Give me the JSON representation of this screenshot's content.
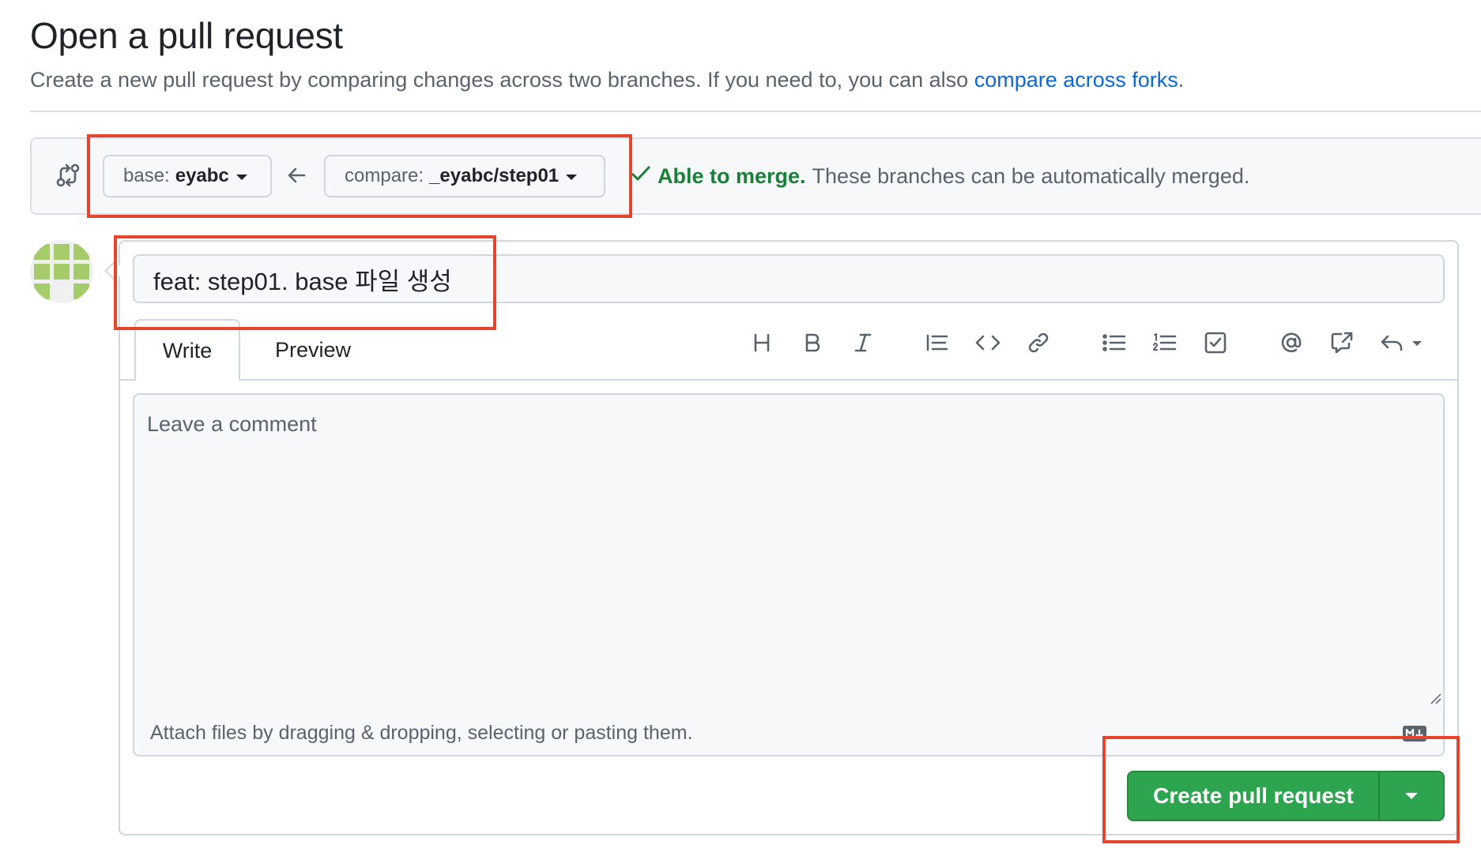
{
  "page": {
    "title": "Open a pull request",
    "subtitle_text": "Create a new pull request by comparing changes across two branches. If you need to, you can also",
    "subtitle_link": "compare across forks",
    "subtitle_end": "."
  },
  "compare": {
    "icon": "git-compare-icon",
    "base_label": "base:",
    "base_value": "eyabc",
    "arrow_icon": "arrow-left-icon",
    "compare_label": "compare:",
    "compare_value": "_eyabc/step01",
    "merge_status": "Able to merge.",
    "merge_description": "These branches can be automatically merged."
  },
  "form": {
    "title_value": "feat: step01. base 파일 생성",
    "tabs": [
      {
        "label": "Write",
        "active": true
      },
      {
        "label": "Preview",
        "active": false
      }
    ],
    "toolbar": [
      "heading-icon",
      "bold-icon",
      "italic-icon",
      "quote-icon",
      "code-icon",
      "link-icon",
      "unordered-list-icon",
      "ordered-list-icon",
      "task-list-icon",
      "mention-icon",
      "cross-reference-icon",
      "reply-icon"
    ],
    "comment_placeholder": "Leave a comment",
    "attach_text": "Attach files by dragging & dropping, selecting or pasting them.",
    "markdown_icon": "markdown-icon",
    "submit_label": "Create pull request"
  },
  "colors": {
    "accent_link": "#0969da",
    "success": "#1a7f37",
    "primary_button": "#2da44e",
    "annotation": "#e5442f"
  }
}
